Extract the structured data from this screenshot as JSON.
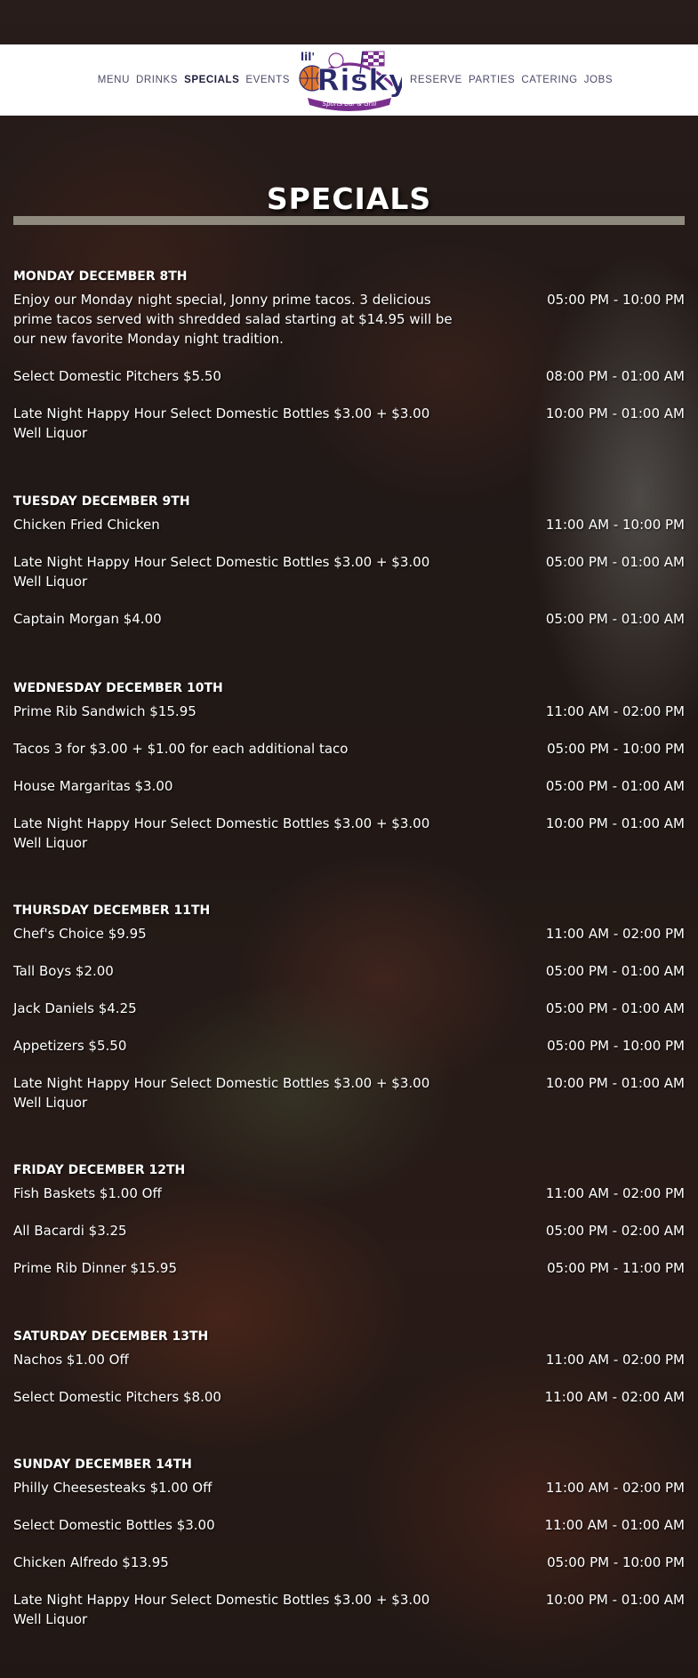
{
  "nav": {
    "left": [
      "MENU",
      "DRINKS",
      "SPECIALS",
      "EVENTS"
    ],
    "right": [
      "RESERVE",
      "PARTIES",
      "CATERING",
      "JOBS"
    ],
    "active": "SPECIALS"
  },
  "logo": {
    "text": "Risky",
    "prefix": "lil'",
    "tagline": "Sports Bar & Grill",
    "colors": {
      "navy": "#2b2a6b",
      "purple": "#7a2f8e",
      "orange": "#e2762b"
    }
  },
  "page": {
    "title": "SPECIALS"
  },
  "days": [
    {
      "heading": "MONDAY DECEMBER 8TH",
      "specials": [
        {
          "desc": "Enjoy our Monday night special, Jonny prime tacos. 3 delicious prime tacos served with shredded salad starting at $14.95 will be our new favorite Monday night tradition.",
          "time": "05:00 PM - 10:00 PM"
        },
        {
          "desc": "Select Domestic Pitchers $5.50",
          "time": "08:00 PM - 01:00 AM"
        },
        {
          "desc": "Late Night Happy Hour Select Domestic Bottles $3.00 + $3.00 Well Liquor",
          "time": "10:00 PM - 01:00 AM"
        }
      ]
    },
    {
      "heading": "TUESDAY DECEMBER 9TH",
      "specials": [
        {
          "desc": "Chicken Fried Chicken",
          "time": "11:00 AM - 10:00 PM"
        },
        {
          "desc": "Late Night Happy Hour Select Domestic Bottles $3.00 + $3.00 Well Liquor",
          "time": "05:00 PM - 01:00 AM"
        },
        {
          "desc": "Captain Morgan $4.00",
          "time": "05:00 PM - 01:00 AM"
        }
      ]
    },
    {
      "heading": "WEDNESDAY DECEMBER 10TH",
      "specials": [
        {
          "desc": "Prime Rib Sandwich $15.95",
          "time": "11:00 AM - 02:00 PM"
        },
        {
          "desc": "Tacos 3 for $3.00 + $1.00 for each additional taco",
          "time": "05:00 PM - 10:00 PM"
        },
        {
          "desc": "House Margaritas $3.00",
          "time": "05:00 PM - 01:00 AM"
        },
        {
          "desc": "Late Night Happy Hour Select Domestic Bottles $3.00 + $3.00 Well Liquor",
          "time": "10:00 PM - 01:00 AM"
        }
      ]
    },
    {
      "heading": "THURSDAY DECEMBER 11TH",
      "specials": [
        {
          "desc": "Chef's Choice $9.95",
          "time": "11:00 AM - 02:00 PM"
        },
        {
          "desc": "Tall Boys $2.00",
          "time": "05:00 PM - 01:00 AM"
        },
        {
          "desc": "Jack Daniels $4.25",
          "time": "05:00 PM - 01:00 AM"
        },
        {
          "desc": "Appetizers $5.50",
          "time": "05:00 PM - 10:00 PM"
        },
        {
          "desc": "Late Night Happy Hour Select Domestic Bottles $3.00 + $3.00 Well Liquor",
          "time": "10:00 PM - 01:00 AM"
        }
      ]
    },
    {
      "heading": "FRIDAY DECEMBER 12TH",
      "specials": [
        {
          "desc": "Fish Baskets $1.00 Off",
          "time": "11:00 AM - 02:00 PM"
        },
        {
          "desc": "All Bacardi $3.25",
          "time": "05:00 PM - 02:00 AM"
        },
        {
          "desc": "Prime Rib Dinner $15.95",
          "time": "05:00 PM - 11:00 PM"
        }
      ]
    },
    {
      "heading": "SATURDAY DECEMBER 13TH",
      "specials": [
        {
          "desc": "Nachos $1.00 Off",
          "time": "11:00 AM - 02:00 PM"
        },
        {
          "desc": "Select Domestic Pitchers $8.00",
          "time": "11:00 AM - 02:00 AM"
        }
      ]
    },
    {
      "heading": "SUNDAY DECEMBER 14TH",
      "specials": [
        {
          "desc": "Philly Cheesesteaks $1.00 Off",
          "time": "11:00 AM - 02:00 PM"
        },
        {
          "desc": "Select Domestic Bottles $3.00",
          "time": "11:00 AM - 01:00 AM"
        },
        {
          "desc": "Chicken Alfredo $13.95",
          "time": "05:00 PM - 10:00 PM"
        },
        {
          "desc": "Late Night Happy Hour Select Domestic Bottles $3.00 + $3.00 Well Liquor",
          "time": "10:00 PM - 01:00 AM"
        }
      ]
    }
  ]
}
